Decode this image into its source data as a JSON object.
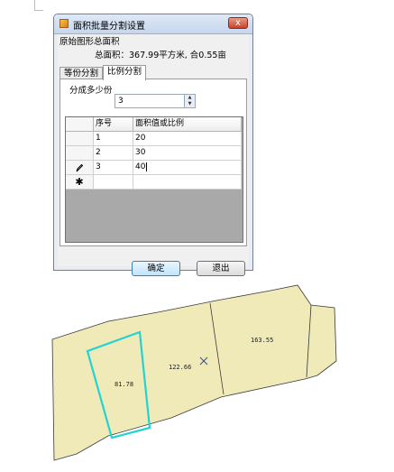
{
  "window": {
    "title": "面积批量分割设置",
    "close_glyph": "x"
  },
  "original_area": {
    "group_label": "原始图形总面积",
    "total_text": "总面积：367.99平方米, 合0.55亩"
  },
  "tabs": [
    {
      "label": "等份分割",
      "active": false
    },
    {
      "label": "比例分割",
      "active": true
    }
  ],
  "split": {
    "label": "分成多少份",
    "count_value": "3"
  },
  "grid": {
    "columns": [
      "序号",
      "面积值或比例"
    ],
    "rows": [
      {
        "index": "1",
        "value": "20",
        "marker": ""
      },
      {
        "index": "2",
        "value": "30",
        "marker": ""
      },
      {
        "index": "3",
        "value": "40",
        "marker": "pencil-icon"
      },
      {
        "index": "",
        "value": "",
        "marker": "new-row-star-icon"
      }
    ]
  },
  "buttons": {
    "ok": "确定",
    "cancel": "退出"
  },
  "map": {
    "fill_color": "#f0eab8",
    "selected_outline_color": "#23d3d3",
    "parcel_labels": [
      "81.78",
      "122.66",
      "163.55"
    ]
  }
}
